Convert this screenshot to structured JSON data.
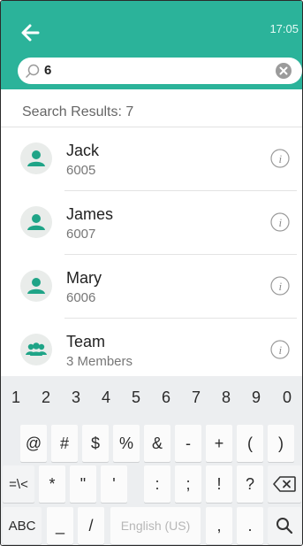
{
  "header": {
    "time": "17:05",
    "search_value": "6"
  },
  "results": {
    "label": "Search Results: 7",
    "items": [
      {
        "name": "Jack",
        "sub": "6005",
        "avatar_icon": "person-icon"
      },
      {
        "name": "James",
        "sub": "6007",
        "avatar_icon": "person-icon"
      },
      {
        "name": "Mary",
        "sub": "6006",
        "avatar_icon": "person-icon"
      },
      {
        "name": "Team",
        "sub": "3 Members",
        "avatar_icon": "group-icon"
      }
    ]
  },
  "keyboard": {
    "row1": [
      "1",
      "2",
      "3",
      "4",
      "5",
      "6",
      "7",
      "8",
      "9",
      "0"
    ],
    "row2": [
      "@",
      "#",
      "$",
      "%",
      "&",
      "-",
      "+",
      "(",
      ")"
    ],
    "row3": [
      "=\\<",
      "*",
      "\"",
      "'",
      ":",
      ";",
      "!",
      "?"
    ],
    "row4": {
      "abc": "ABC",
      "underscore": "_",
      "slash": "/",
      "space": "English (US)",
      "comma": ",",
      "period": "."
    }
  },
  "colors": {
    "accent": "#2bb39a",
    "keyboard_bg": "#eceef0"
  }
}
